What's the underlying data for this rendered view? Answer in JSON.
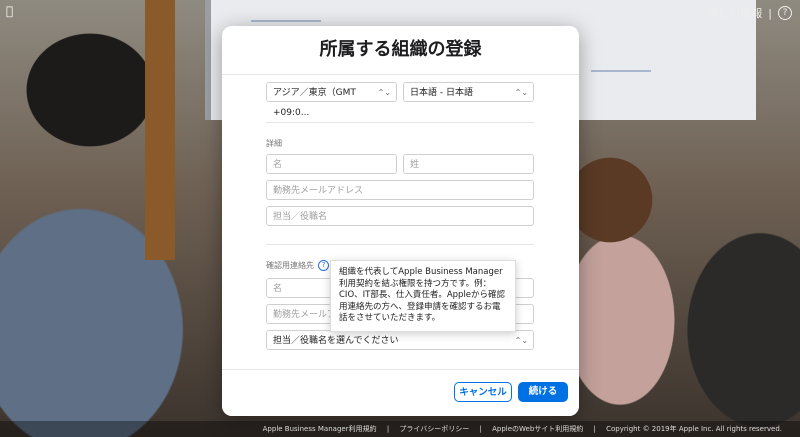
{
  "app": {
    "logo_icon": "apple-icon"
  },
  "top_right": {
    "link": "詳しい情報",
    "sep": "|",
    "help": "?"
  },
  "modal": {
    "title": "所属する組織の登録",
    "timezone": {
      "value": "アジア／東京（GMT +09:0..."
    },
    "language": {
      "value": "日本語 - 日本語"
    },
    "details": {
      "label": "詳細",
      "first_name_placeholder": "名",
      "last_name_placeholder": "姓",
      "email_placeholder": "勤務先メールアドレス",
      "role_placeholder": "担当／役職名"
    },
    "verification": {
      "label": "確認用連絡先",
      "first_name_placeholder": "名",
      "email_placeholder": "勤務先メールアドレス",
      "role_select": "担当／役職名を選んでください"
    },
    "tooltip": "組織を代表してApple Business Manager利用契約を結ぶ権限を持つ方です。例：CIO、IT部長、仕入責任者。Appleから確認用連絡先の方へ、登録申請を確認するお電話をさせていただきます。",
    "buttons": {
      "cancel": "キャンセル",
      "continue": "続ける"
    }
  },
  "footer_links": [
    "Apple Business Manager利用規約",
    "|",
    "プライバシーポリシー",
    "|",
    "AppleのWebサイト利用規約",
    "|",
    "Copyright © 2019年 Apple Inc. All rights reserved."
  ]
}
